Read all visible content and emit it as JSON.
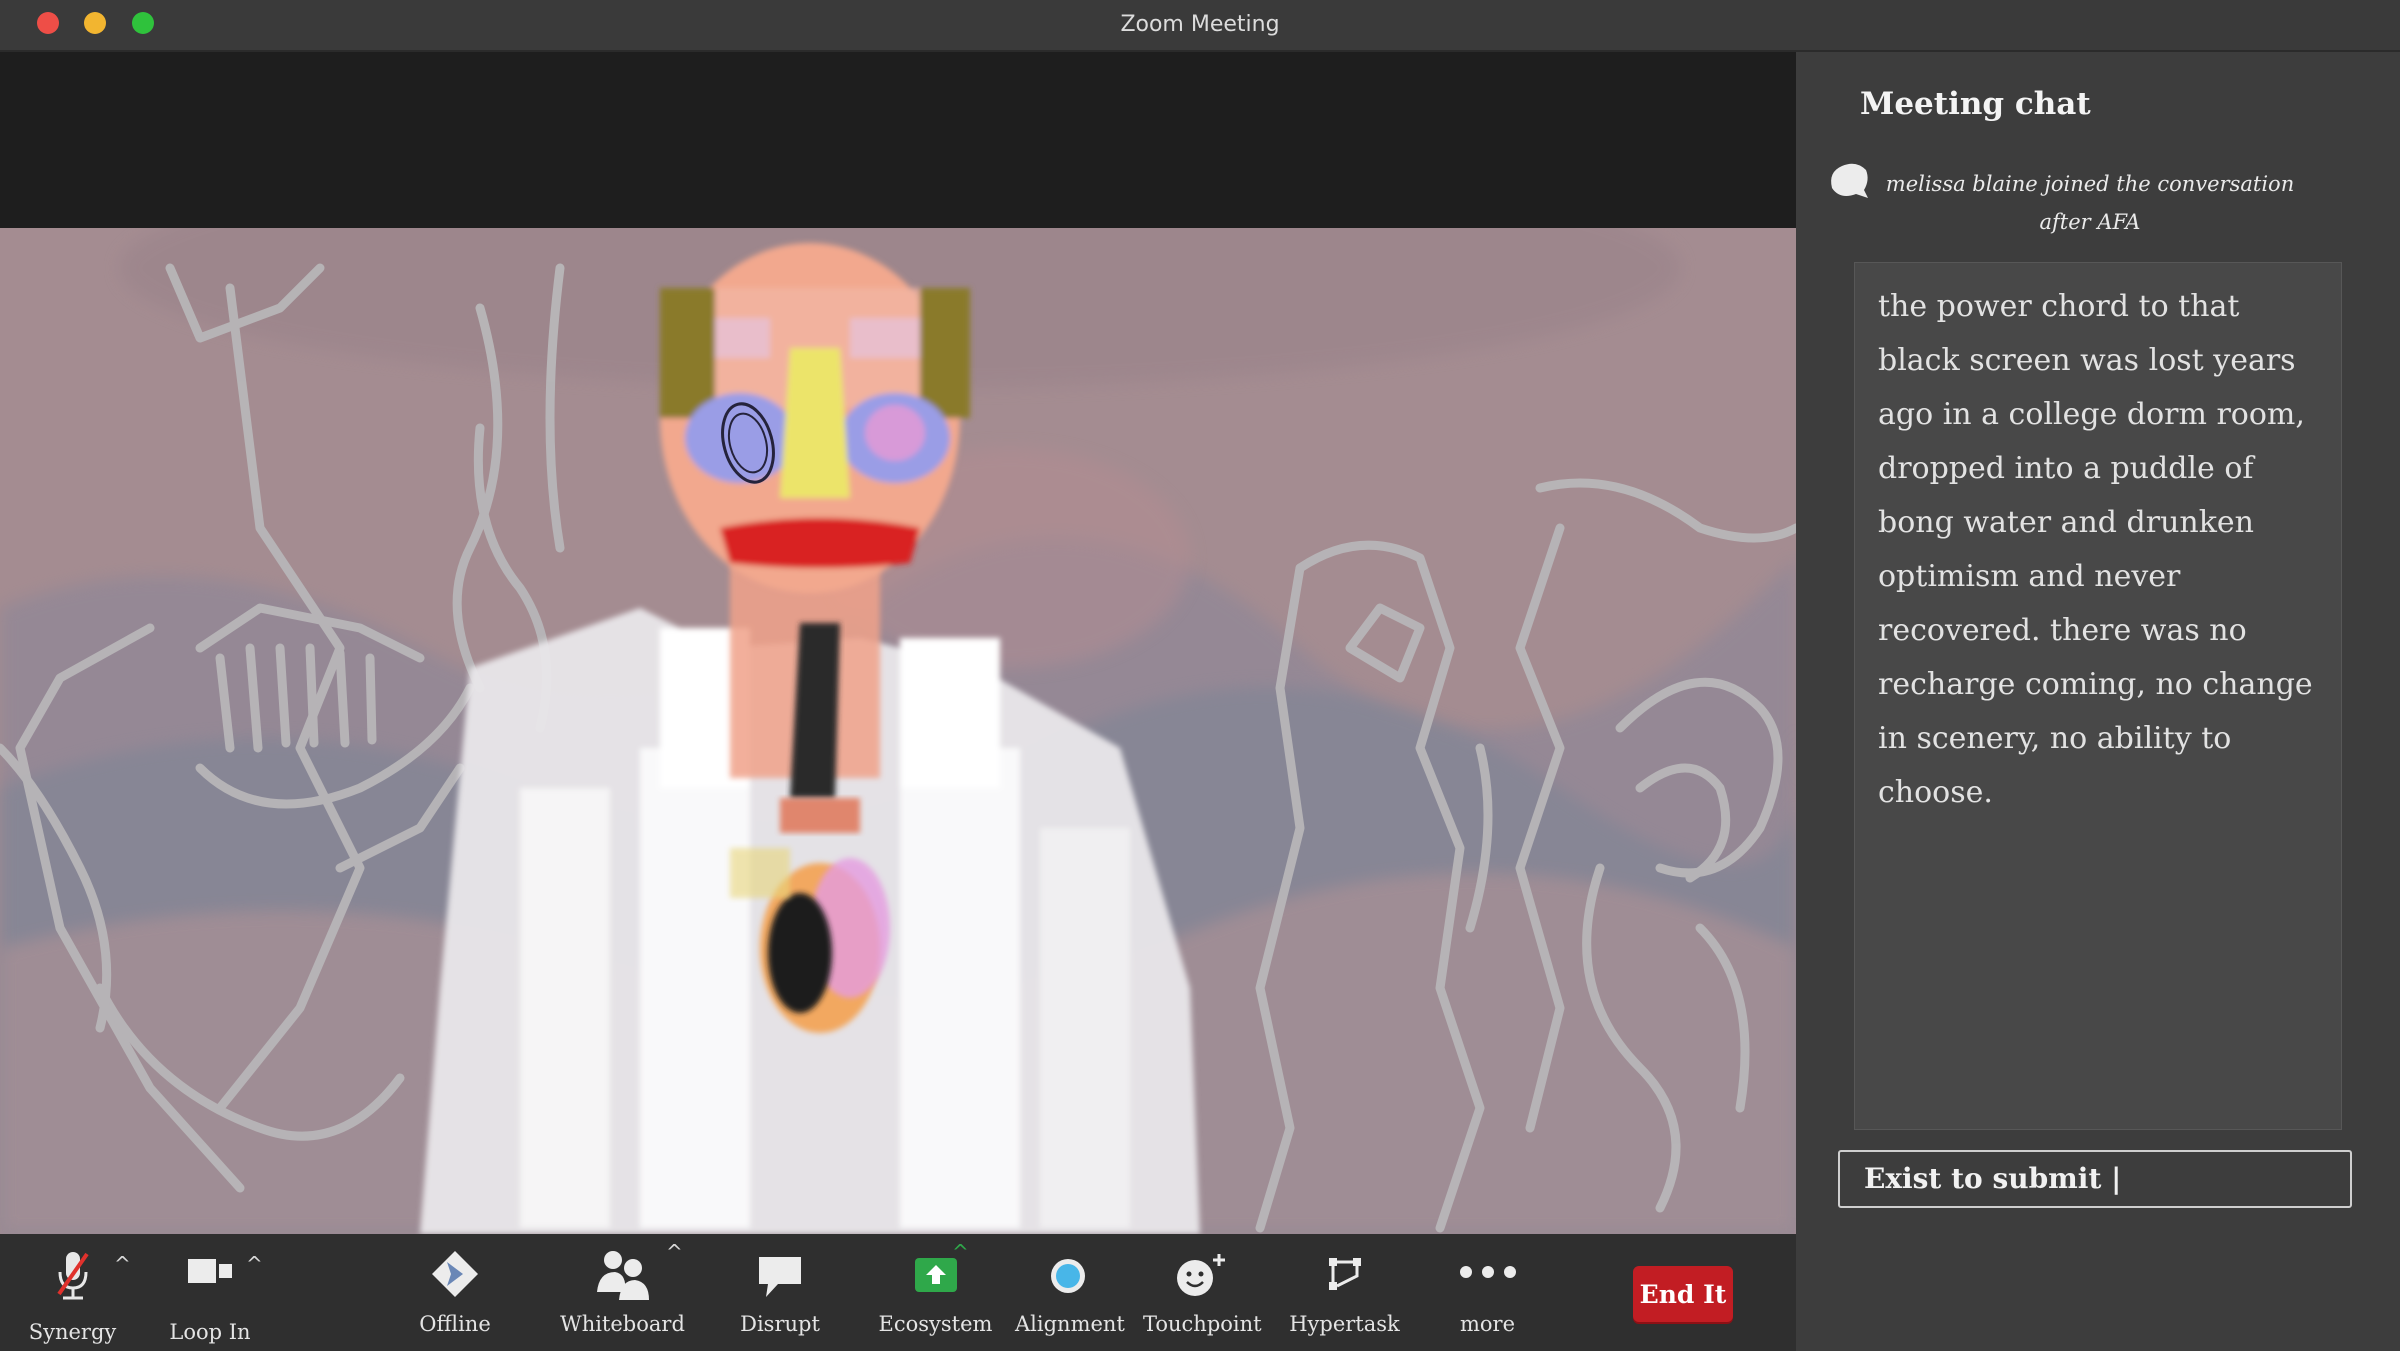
{
  "window": {
    "title": "Zoom Meeting",
    "traffic_lights": {
      "close": "#ee4e47",
      "minimize": "#f2b530",
      "zoom": "#2fc23c"
    }
  },
  "toolbar": {
    "items": [
      {
        "label": "Synergy",
        "icon": "muted-microphone-icon"
      },
      {
        "label": "Loop In",
        "icon": "video-camera-icon"
      },
      {
        "label": "Offline",
        "icon": "diamond-icon"
      },
      {
        "label": "Whiteboard",
        "icon": "people-icon"
      },
      {
        "label": "Disrupt",
        "icon": "speech-bubble-icon"
      },
      {
        "label": "Ecosystem",
        "icon": "share-screen-icon"
      },
      {
        "label": "Alignment",
        "icon": "blue-circle-icon"
      },
      {
        "label": "Touchpoint",
        "icon": "smiley-plus-icon"
      },
      {
        "label": "Hypertask",
        "icon": "flowchart-icon"
      },
      {
        "label": "more",
        "icon": "ellipsis-icon"
      }
    ],
    "end_label": "End It",
    "end_color": "#c21d23",
    "accent_green": "#2fa84a"
  },
  "chat": {
    "title": "Meeting chat",
    "join_message": "melissa blaine  joined the conversation after AFA",
    "message": "the power chord to that black screen was lost years ago in a college dorm room, dropped into a puddle of bong water and drunken optimism and never recovered. there was no recharge coming, no change in scenery, no ability to choose.",
    "input_value": "Exist to submit |"
  }
}
